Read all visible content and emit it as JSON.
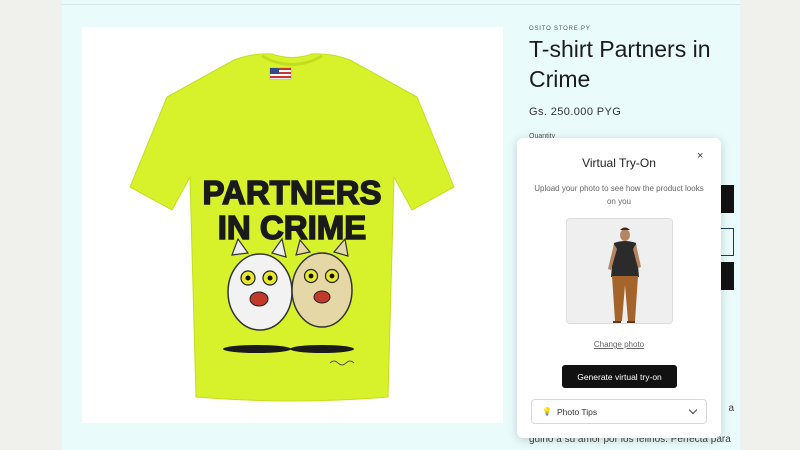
{
  "product": {
    "vendor": "OSITO STORE PY",
    "title": "T-shirt Partners in Crime",
    "price": "Gs. 250.000 PYG",
    "quantity_label": "Quantity",
    "description_line": "a",
    "description_last": "guiño a su amor por los felinos. Perfecta para"
  },
  "shirt_print": {
    "line1": "PARTNERS",
    "line2": "IN CRIME"
  },
  "modal": {
    "title": "Virtual Try-On",
    "close": "×",
    "subtitle": "Upload your photo to see how the product looks on you",
    "change_photo": "Change photo",
    "generate_button": "Generate virtual try-on",
    "tips_label": "Photo Tips",
    "tips_icon": "lightbulb-icon"
  },
  "colors": {
    "shirt": "#d7f22a",
    "background": "#e9fbfb",
    "button": "#111111"
  }
}
